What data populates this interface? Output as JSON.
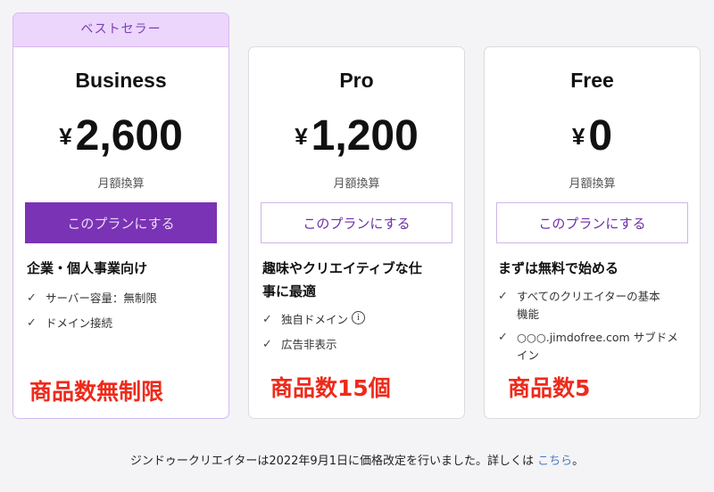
{
  "plans": [
    {
      "ribbon": "ベストセラー",
      "name": "Business",
      "currency": "¥",
      "price": "2,600",
      "billing_note": "月額換算",
      "cta_label": "このプランにする",
      "tagline": "企業・個人事業向け",
      "features": [
        "サーバー容量：無制限",
        "ドメイン接続"
      ],
      "annotation": "商品数無制限"
    },
    {
      "name": "Pro",
      "currency": "¥",
      "price": "1,200",
      "billing_note": "月額換算",
      "cta_label": "このプランにする",
      "tagline_line1": "趣味やクリエイティブな仕",
      "tagline_line2": "事に最適",
      "features": [
        "独自ドメイン",
        "広告非表示"
      ],
      "info_icon": "i",
      "annotation": "商品数15個"
    },
    {
      "name": "Free",
      "currency": "¥",
      "price": "0",
      "billing_note": "月額換算",
      "cta_label": "このプランにする",
      "tagline": "まずは無料で始める",
      "features": [
        {
          "line1": "すべてのクリエイターの基本",
          "line2": "機能"
        },
        {
          "line1": "○○○.jimdofree.com サブドメ",
          "line2": "イン"
        }
      ],
      "annotation": "商品数5"
    }
  ],
  "footer": {
    "text": "ジンドゥークリエイターは2022年9月1日に価格改定を行いました。詳しくは ",
    "link": "こちら",
    "suffix": "。"
  },
  "colors": {
    "accent": "#7a33b4",
    "ribbon_bg": "#ecd6fb",
    "annotation": "#ee2a1b",
    "link": "#4a7ac0"
  }
}
